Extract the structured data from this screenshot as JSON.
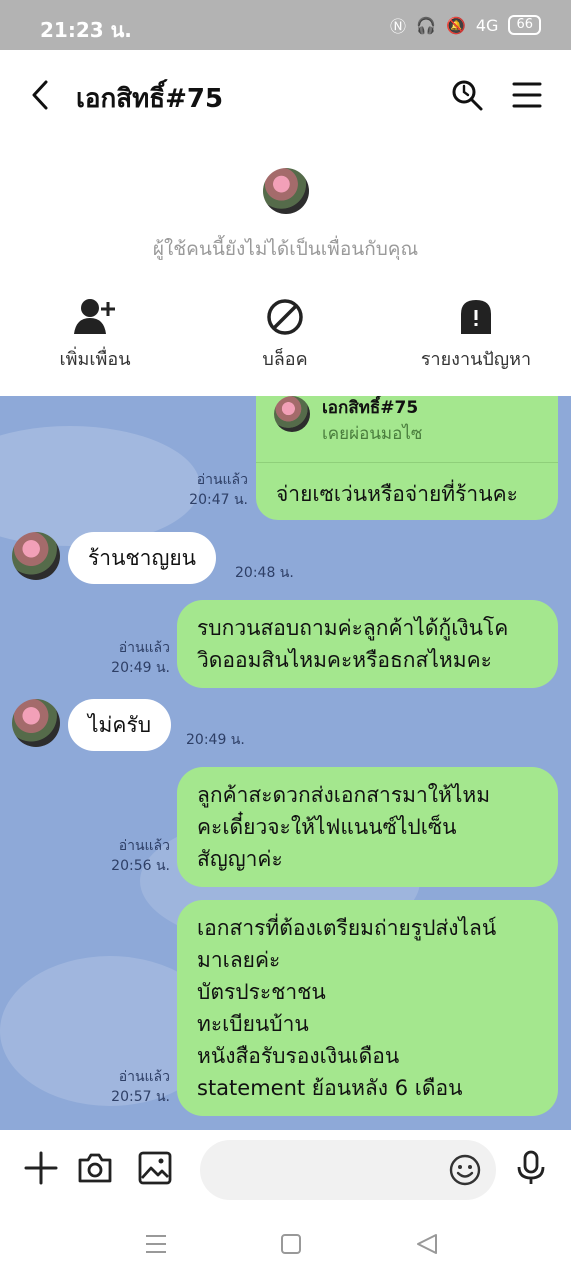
{
  "status": {
    "time": "21:23 น.",
    "battery": "66",
    "signal": "4G"
  },
  "header": {
    "title": "เอกสิทธิ์#75"
  },
  "profile": {
    "note": "ผู้ใช้คนนี้ยังไม่ได้เป็นเพื่อนกับคุณ",
    "actions": [
      {
        "label": "เพิ่มเพื่อน",
        "icon": "add-friend-icon"
      },
      {
        "label": "บล็อค",
        "icon": "block-icon"
      },
      {
        "label": "รายงานปัญหา",
        "icon": "report-icon"
      }
    ]
  },
  "chat": {
    "quote": {
      "name": "เอกสิทธิ์#75",
      "text": "เคยผ่อนมอไซ",
      "reply": "จ่ายเซเว่นหรือจ่ายที่ร้านคะ",
      "read": "อ่านแล้ว",
      "time": "20:47 น."
    },
    "messages": [
      {
        "side": "left",
        "text": "ร้านชาญยน",
        "time": "20:48 น."
      },
      {
        "side": "right",
        "lines": [
          "รบกวนสอบถามค่ะลูกค้าได้กู้เงินโค",
          "วิดออมสินไหมคะหรือธกสไหมคะ"
        ],
        "read": "อ่านแล้ว",
        "time": "20:49 น."
      },
      {
        "side": "left",
        "text": "ไม่ครับ",
        "time": "20:49 น."
      },
      {
        "side": "right",
        "lines": [
          "ลูกค้าสะดวกส่งเอกสารมาให้ไหม",
          "คะเดี๋ยวจะให้ไฟแนนซ์ไปเซ็น",
          "สัญญาค่ะ"
        ],
        "read": "อ่านแล้ว",
        "time": "20:56 น."
      },
      {
        "side": "right",
        "lines": [
          "เอกสารที่ต้องเตรียมถ่ายรูปส่งไลน์",
          "มาเลยค่ะ",
          "บัตรประชาชน",
          "ทะเบียนบ้าน",
          "หนังสือรับรองเงินเดือน",
          "statement ย้อนหลัง 6 เดือน"
        ],
        "read": "อ่านแล้ว",
        "time": "20:57 น."
      }
    ]
  },
  "colors": {
    "chat_bg": "#8ea9d8",
    "bubble_green": "#a4e78e",
    "bubble_white": "#ffffff",
    "status_bar": "#b3b3b3"
  }
}
